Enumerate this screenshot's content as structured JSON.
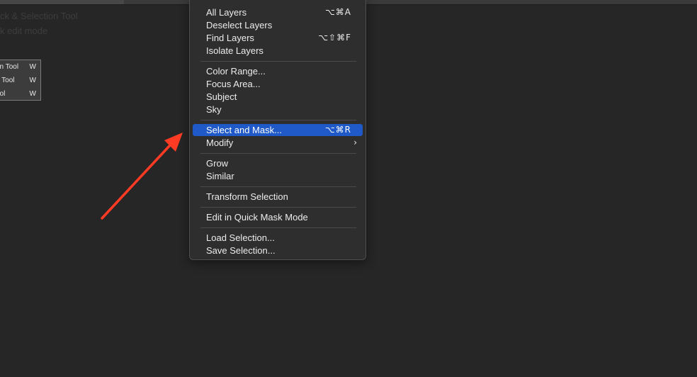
{
  "background_text": {
    "line1": "ck & Selection Tool",
    "line2": "k edit mode"
  },
  "flyout": {
    "items": [
      {
        "label": "on Tool",
        "shortcut": "W"
      },
      {
        "label": "n Tool",
        "shortcut": "W"
      },
      {
        "label": "ool",
        "shortcut": "W"
      }
    ]
  },
  "menu": {
    "items": [
      {
        "label": "All Layers",
        "shortcut": "⌥⌘A"
      },
      {
        "label": "Deselect Layers",
        "shortcut": ""
      },
      {
        "label": "Find Layers",
        "shortcut": "⌥⇧⌘F"
      },
      {
        "label": "Isolate Layers",
        "shortcut": ""
      },
      {
        "label": "Color Range...",
        "shortcut": ""
      },
      {
        "label": "Focus Area...",
        "shortcut": ""
      },
      {
        "label": "Subject",
        "shortcut": ""
      },
      {
        "label": "Sky",
        "shortcut": ""
      },
      {
        "label": "Select and Mask...",
        "shortcut": "⌥⌘R"
      },
      {
        "label": "Modify",
        "shortcut": "",
        "submenu": "chevron-right-icon"
      },
      {
        "label": "Grow",
        "shortcut": ""
      },
      {
        "label": "Similar",
        "shortcut": ""
      },
      {
        "label": "Transform Selection",
        "shortcut": ""
      },
      {
        "label": "Edit in Quick Mask Mode",
        "shortcut": ""
      },
      {
        "label": "Load Selection...",
        "shortcut": ""
      },
      {
        "label": "Save Selection...",
        "shortcut": ""
      }
    ],
    "submenu_glyph": "›",
    "highlight_color": "#1f5ac8"
  },
  "annotation": {
    "arrow_color": "#ff3b24"
  }
}
